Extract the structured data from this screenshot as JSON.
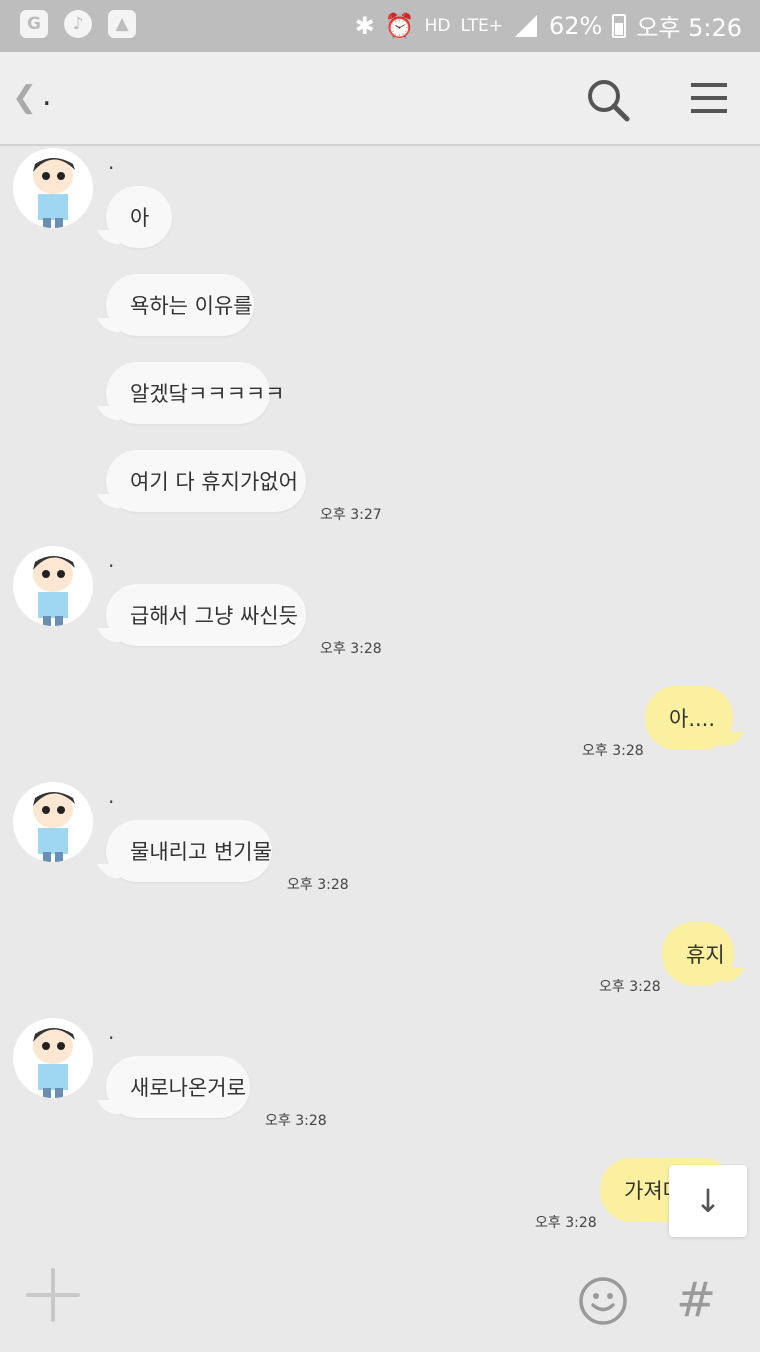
{
  "status_bar": {
    "battery_percent": "62%",
    "network": "LTE+",
    "hd": "HD",
    "time": "오후 5:26",
    "icons": [
      "carrier-g-icon",
      "music-icon",
      "gallery-icon",
      "bluetooth-icon",
      "alarm-icon",
      "signal-icon",
      "battery-icon"
    ]
  },
  "header": {
    "back_label": "❮",
    "title": "."
  },
  "messages": [
    {
      "dir": "in",
      "sender": ".",
      "text": "아"
    },
    {
      "dir": "in",
      "text": "욕하는 이유를"
    },
    {
      "dir": "in",
      "text": "알겠닼ㅋㅋㅋㅋㅋ"
    },
    {
      "dir": "in",
      "text": "여기 다 휴지가없어",
      "time": "오후 3:27"
    },
    {
      "dir": "in",
      "sender": ".",
      "text": "급해서 그냥 싸신듯",
      "time": "오후 3:28"
    },
    {
      "dir": "out",
      "text": "아....",
      "time": "오후 3:28"
    },
    {
      "dir": "in",
      "sender": ".",
      "text": "물내리고 변기물",
      "time": "오후 3:28"
    },
    {
      "dir": "out",
      "text": "휴지",
      "time": "오후 3:28"
    },
    {
      "dir": "in",
      "sender": ".",
      "text": "새로나온거로",
      "time": "오후 3:28"
    },
    {
      "dir": "out",
      "text": "가져다줄게",
      "time": "오후 3:28"
    }
  ],
  "scroll_button_label": "↓",
  "input_bar": {
    "hash_label": "#"
  },
  "colors": {
    "incoming": "#f8f8f8",
    "outgoing": "#fbf0a0",
    "background": "#e9e9e9"
  }
}
